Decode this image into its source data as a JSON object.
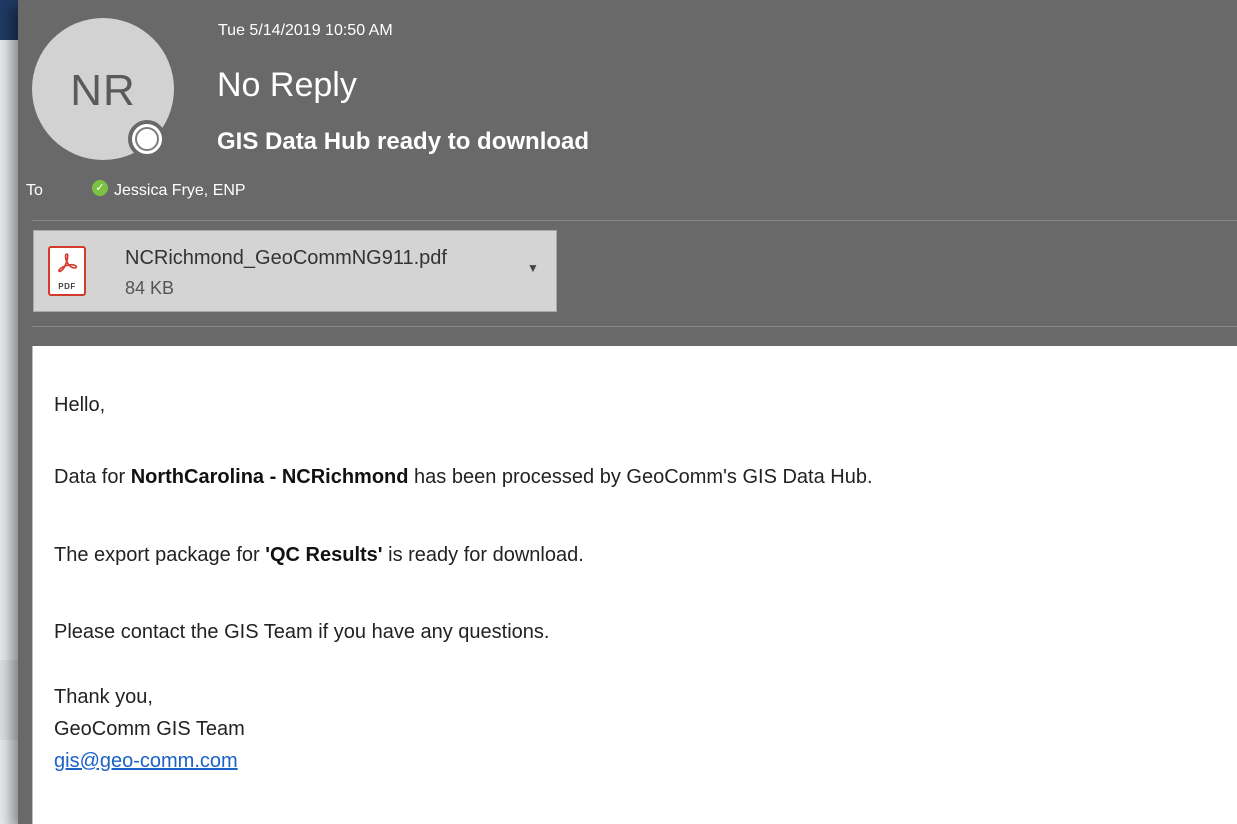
{
  "header": {
    "avatar_initials": "NR",
    "date": "Tue 5/14/2019 10:50 AM",
    "sender": "No Reply",
    "subject": "GIS Data Hub ready to download"
  },
  "recipients": {
    "to_label": "To",
    "to_name": "Jessica Frye, ENP"
  },
  "attachment": {
    "filename": "NCRichmond_GeoCommNG911.pdf",
    "size": "84 KB",
    "icon": "pdf-file-icon",
    "icon_text": "PDF"
  },
  "message": {
    "greeting": "Hello,",
    "line1_prefix": "Data for ",
    "line1_bold": "NorthCarolina - NCRichmond",
    "line1_suffix": " has been processed by GeoComm's GIS Data Hub.",
    "line2_prefix": "The export package for ",
    "line2_bold": "'QC Results'",
    "line2_suffix": " is ready for download.",
    "line3": "Please contact the GIS Team if you have any questions.",
    "signoff": "Thank you,",
    "signature": "GeoComm GIS Team",
    "email_link": "gis@geo-comm.com"
  },
  "colors": {
    "header_bg": "#696969",
    "presence_ok": "#7dc143",
    "pdf_red": "#d33a2c",
    "link": "#1a62c8"
  }
}
